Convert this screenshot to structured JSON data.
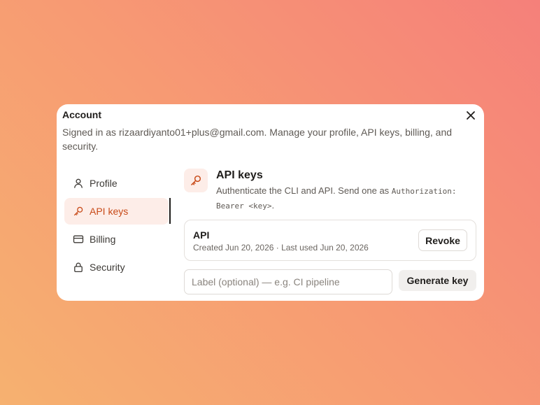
{
  "dialog": {
    "title": "Account",
    "subtitle": "Signed in as rizaardiyanto01+plus@gmail.com. Manage your profile, API keys, billing, and security."
  },
  "nav": {
    "items": [
      {
        "label": "Profile",
        "icon": "user-icon"
      },
      {
        "label": "API keys",
        "icon": "key-icon",
        "active": true
      },
      {
        "label": "Billing",
        "icon": "credit-card-icon"
      },
      {
        "label": "Security",
        "icon": "lock-icon"
      }
    ]
  },
  "api_keys": {
    "title": "API keys",
    "desc_text": "Authenticate the CLI and API. Send one as ",
    "desc_code": "Authorization: Bearer <key>",
    "desc_end": ".",
    "keys": [
      {
        "name": "API",
        "meta": "Created Jun 20, 2026 · Last used Jun 20, 2026",
        "revoke_label": "Revoke"
      }
    ],
    "input_placeholder": "Label (optional) — e.g. CI pipeline",
    "generate_label": "Generate key"
  },
  "colors": {
    "accent": "#c84a18",
    "accent_bg": "#fdede8",
    "active_indicator": "#1f1d1b"
  }
}
